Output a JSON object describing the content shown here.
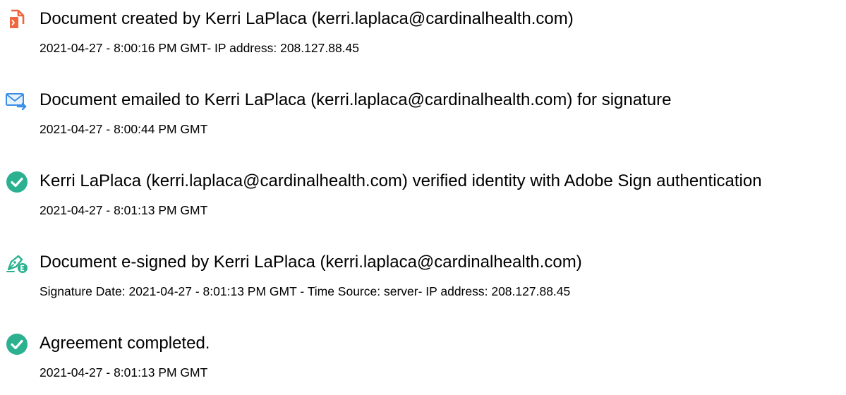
{
  "colors": {
    "created_icon": "#f0673d",
    "emailed_icon": "#3a8ee6",
    "check_icon": "#2bb190",
    "signed_icon": "#2bb190"
  },
  "events": [
    {
      "icon": "document-created-icon",
      "title": "Document created by Kerri LaPlaca (kerri.laplaca@cardinalhealth.com)",
      "meta": "2021-04-27 - 8:00:16 PM GMT- IP address: 208.127.88.45"
    },
    {
      "icon": "email-forward-icon",
      "title": "Document emailed to Kerri LaPlaca (kerri.laplaca@cardinalhealth.com) for signature",
      "meta": "2021-04-27 - 8:00:44 PM GMT"
    },
    {
      "icon": "check-circle-icon",
      "title": "Kerri LaPlaca (kerri.laplaca@cardinalhealth.com) verified identity with Adobe Sign authentication",
      "meta": "2021-04-27 - 8:01:13 PM GMT"
    },
    {
      "icon": "pen-esign-icon",
      "title": "Document e-signed by Kerri LaPlaca (kerri.laplaca@cardinalhealth.com)",
      "meta": "Signature Date: 2021-04-27 - 8:01:13 PM GMT - Time Source: server- IP address: 208.127.88.45"
    },
    {
      "icon": "check-circle-icon",
      "title": "Agreement completed.",
      "meta": "2021-04-27 - 8:01:13 PM GMT"
    }
  ]
}
